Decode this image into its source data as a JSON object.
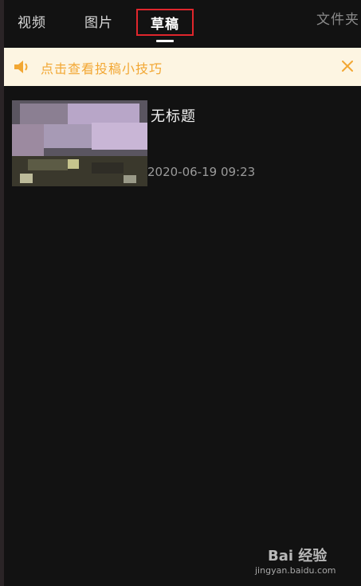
{
  "tabs": {
    "videos": "视频",
    "pictures": "图片",
    "drafts": "草稿",
    "folders": "文件夹"
  },
  "tip": {
    "icon": "speaker-icon",
    "text": "点击查看投稿小技巧",
    "close_icon": "close-icon",
    "accent_color": "#f2a733",
    "background": "#fdf5e2"
  },
  "drafts": [
    {
      "title": "无标题",
      "date": "2020-06-19 09:23"
    }
  ],
  "watermark": {
    "logo": "Bai 经验",
    "url": "jingyan.baidu.com"
  },
  "colors": {
    "background": "#121212",
    "selected_border": "#e0262c"
  }
}
